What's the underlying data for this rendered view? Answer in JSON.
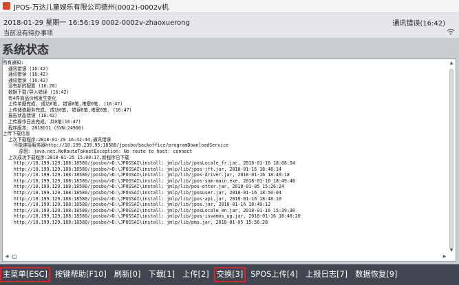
{
  "window": {
    "title": "JPOS-万达儿童娱乐有限公司德州(0002)-0002v机"
  },
  "header": {
    "datetime_line": "2018-01-29 星期一 16:56:19 0002-0002v-zhaoxuerong",
    "todo_text": "当前没有待办事项",
    "connection_status": "通讯错误(16:42)",
    "status_icon": "wifi-icon"
  },
  "page": {
    "title": "系统状态"
  },
  "log": {
    "lines": [
      "所有通知:",
      "  通讯错误 (16:42)",
      "  通讯错误 (16:42)",
      "  通讯错误 (16:42)",
      "  没有新的配置 (16:20)",
      "  数据下载/导入错误 (16:42)",
      "  有4件商品价格发生变化",
      "  上传单据完成, 成功0笔, 错误0笔,堵塞0笔. (16:47)",
      "  上传储值服务完成, 成功0笔, 错误0笔,堵塞0笔. (16:47)",
      "  报告状态错误 (16:42)",
      "  上传操作日志完成, 共0笔(16:47)",
      "  程序版本: 2018011 (SVN:24960)",
      "上传下载信息",
      "  上次下载程序:2018-01-29 16:42:44,通讯错误",
      "    不能连接服务器http://10.199.239.95:18580/jposbo/backoffice/programDownloadService",
      "      原因: java.net.NoRouteToHostException: No route to host: connect",
      "  上次成功下载程序:2018-01-25 15:00:17,新程序已下载",
      "    http://10.199.129.188:18580/jposbo/>D:\\JPOSSAI\\install: jmlp/lib/jposLocale_fr.jar, 2018-01-16 18:08:54",
      "    http://10.199.129.188:18580/jposbo/>D:\\JPOSSAI\\install: jmlp/lib/jpos-jft.jar, 2018-01-16 18:48:14",
      "    http://10.199.129.188:18580/jposbo/>D:\\JPOSSAI\\install: jmlp/lib/jpos-driver.jar, 2018-01-16 18:49:18",
      "    http://10.199.129.188:18580/jposbo/>D:\\JPOSSAI\\install: jmlp/lib/jpos-sam-main.exe, 2018-01-16 18:49:48",
      "    http://10.199.129.188:18580/jposbo/>D:\\JPOSSAI\\install: jmlp/lib/pos-otter.jar, 2018-01-05 15:26:24",
      "    http://10.199.129.188:18580/jposbo/>D:\\JPOSSAI\\install: jmlp/lib/jposuser.jar, 2018-01-16 18:50:04",
      "    http://10.199.129.188:18580/jposbo/>D:\\JPOSSAI\\install: jmlp/lib/jpos-api.jar, 2018-01-16 18:48:10",
      "    http://10.199.129.188:18580/jposbo/>D:\\JPOSSAI\\install: jmlp/lib/jpos.jar, 2018-01-16 18:49:12",
      "    http://10.199.129.188:18580/jposbo/>D:\\JPOSSAI\\install: jmlp/lib/jposLocale_en.jar, 2018-01-16 15:39:30",
      "    http://10.199.129.188:18580/jposbo/>D:\\JPOSSAI\\install: jmlp/lib/jpos-isvamos_ug.jar, 2018-01-16 18:48:20",
      "    http://10.199.129.188:18580/jposbo/>D:\\JPOSSAI\\install: jmlp/lib/pms.jar, 2018-01-05 15:56:28"
    ]
  },
  "bottombar": {
    "buttons": [
      {
        "label": "主菜单[ESC]",
        "highlighted": true
      },
      {
        "label": "按键帮助[F10]",
        "highlighted": false
      },
      {
        "label": "刷新[0]",
        "highlighted": false
      },
      {
        "label": "下载[1]",
        "highlighted": false
      },
      {
        "label": "上传[2]",
        "highlighted": false
      },
      {
        "label": "交换[3]",
        "highlighted": true
      },
      {
        "label": "SPOS上传[4]",
        "highlighted": false
      },
      {
        "label": "上报日志[7]",
        "highlighted": false
      },
      {
        "label": "数据恢复[9]",
        "highlighted": false
      }
    ]
  },
  "colors": {
    "bottombar_bg": "#3f4650",
    "highlight_border": "#e0202a",
    "app_icon": "#d9482b"
  }
}
